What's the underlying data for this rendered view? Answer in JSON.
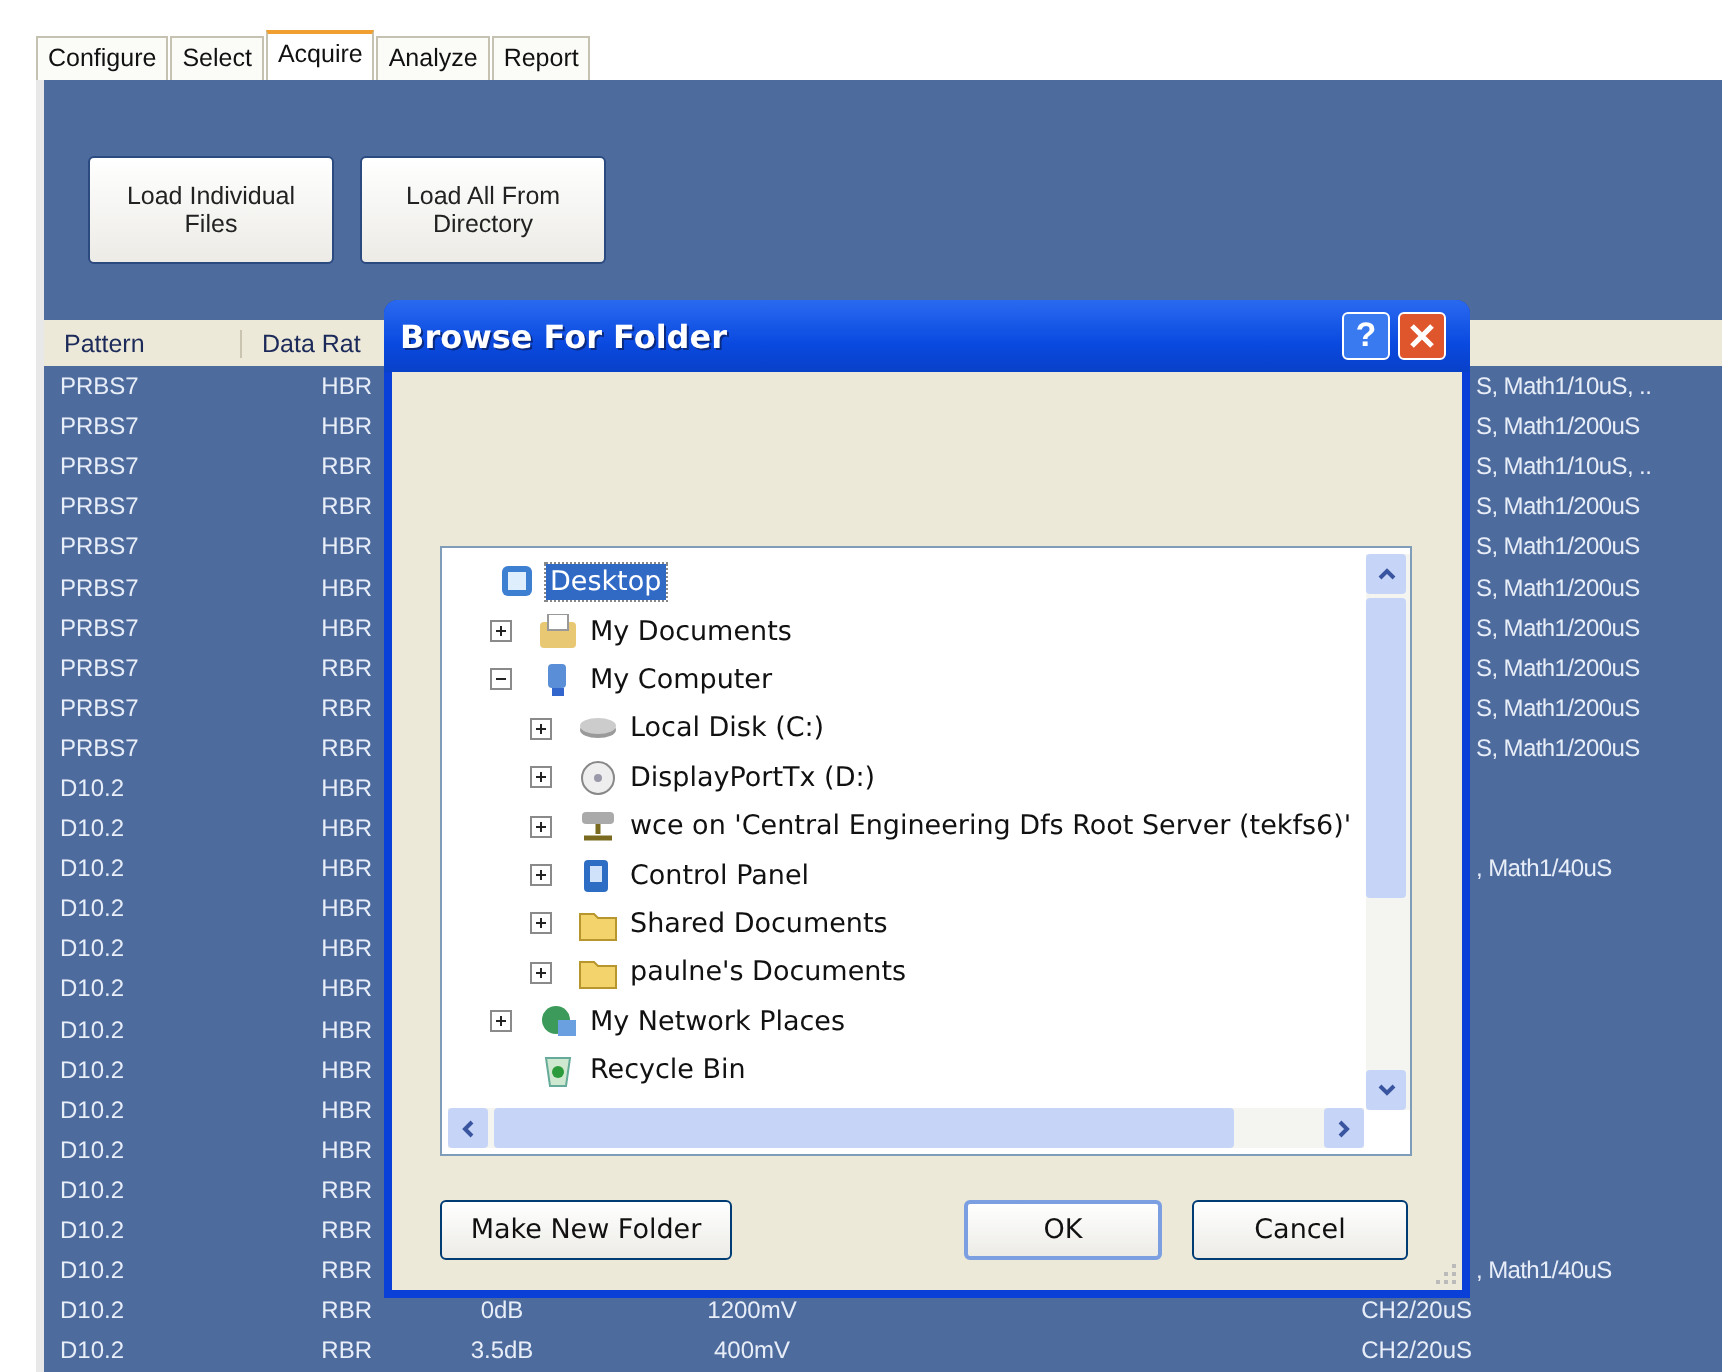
{
  "tabs": [
    {
      "label": "Configure",
      "selected": false
    },
    {
      "label": "Select",
      "selected": false
    },
    {
      "label": "Acquire",
      "selected": true
    },
    {
      "label": "Analyze",
      "selected": false
    },
    {
      "label": "Report",
      "selected": false
    }
  ],
  "actions": [
    "Load Individual Files",
    "Load All From Directory"
  ],
  "table": {
    "columns": [
      "Pattern",
      "Data Rat"
    ],
    "rows": [
      {
        "pattern": "PRBS7",
        "data_rate": "HBR",
        "column_6": "S, Math1/10uS, .."
      },
      {
        "pattern": "PRBS7",
        "data_rate": "HBR",
        "column_6": "S, Math1/200uS"
      },
      {
        "pattern": "PRBS7",
        "data_rate": "RBR",
        "column_6": "S, Math1/10uS, .."
      },
      {
        "pattern": "PRBS7",
        "data_rate": "RBR",
        "column_6": "S, Math1/200uS"
      },
      {
        "pattern": "PRBS7",
        "data_rate": "HBR",
        "column_6": "S, Math1/200uS"
      },
      {
        "pattern": "PRBS7",
        "data_rate": "HBR",
        "column_6": "S, Math1/200uS"
      },
      {
        "pattern": "PRBS7",
        "data_rate": "HBR",
        "column_6": "S, Math1/200uS"
      },
      {
        "pattern": "PRBS7",
        "data_rate": "RBR",
        "column_6": "S, Math1/200uS"
      },
      {
        "pattern": "PRBS7",
        "data_rate": "RBR",
        "column_6": "S, Math1/200uS"
      },
      {
        "pattern": "PRBS7",
        "data_rate": "RBR",
        "column_6": "S, Math1/200uS"
      },
      {
        "pattern": "D10.2",
        "data_rate": "HBR"
      },
      {
        "pattern": "D10.2",
        "data_rate": "HBR"
      },
      {
        "pattern": "D10.2",
        "data_rate": "HBR",
        "column_6": ", Math1/40uS"
      },
      {
        "pattern": "D10.2",
        "data_rate": "HBR"
      },
      {
        "pattern": "D10.2",
        "data_rate": "HBR"
      },
      {
        "pattern": "D10.2",
        "data_rate": "HBR"
      },
      {
        "pattern": "D10.2",
        "data_rate": "HBR"
      },
      {
        "pattern": "D10.2",
        "data_rate": "HBR"
      },
      {
        "pattern": "D10.2",
        "data_rate": "HBR"
      },
      {
        "pattern": "D10.2",
        "data_rate": "HBR"
      },
      {
        "pattern": "D10.2",
        "data_rate": "RBR"
      },
      {
        "pattern": "D10.2",
        "data_rate": "RBR"
      },
      {
        "pattern": "D10.2",
        "data_rate": "RBR",
        "column_6": ", Math1/40uS"
      },
      {
        "pattern": "D10.2",
        "data_rate": "RBR",
        "column_3": "0dB",
        "column_4": "1200mV",
        "column_5": "CH2/20uS"
      },
      {
        "pattern": "D10.2",
        "data_rate": "RBR",
        "column_3": "3.5dB",
        "column_4": "400mV",
        "column_5": "CH2/20uS"
      }
    ]
  },
  "dialog": {
    "title": "Browse For Folder",
    "help": "?",
    "tree": [
      {
        "label": "Desktop",
        "kind": "desktop",
        "selected": true,
        "children": [
          {
            "label": "My Documents",
            "kind": "documents",
            "selected": false,
            "expanded": false
          },
          {
            "label": "My Computer",
            "kind": "computer",
            "selected": false,
            "expanded": true,
            "children": [
              {
                "label": "Local Disk (C:)",
                "kind": "disk",
                "selected": false,
                "expanded": false
              },
              {
                "label": "DisplayPortTx (D:)",
                "kind": "cd",
                "selected": false,
                "expanded": false
              },
              {
                "label": "wce on 'Central Engineering Dfs Root Server (tekfs6)'",
                "kind": "network-drive",
                "selected": false,
                "expanded": false
              },
              {
                "label": "Control Panel",
                "kind": "control-panel",
                "selected": false,
                "expanded": false
              },
              {
                "label": "Shared Documents",
                "kind": "folder",
                "selected": false,
                "expanded": false
              },
              {
                "label": "paulne's Documents",
                "kind": "folder",
                "selected": false,
                "expanded": false
              }
            ]
          },
          {
            "label": "My Network Places",
            "kind": "network",
            "selected": false,
            "expanded": false
          },
          {
            "label": "Recycle Bin",
            "kind": "recycle",
            "selected": false
          }
        ]
      }
    ],
    "buttons": [
      "Make New Folder",
      "OK",
      "Cancel"
    ]
  }
}
